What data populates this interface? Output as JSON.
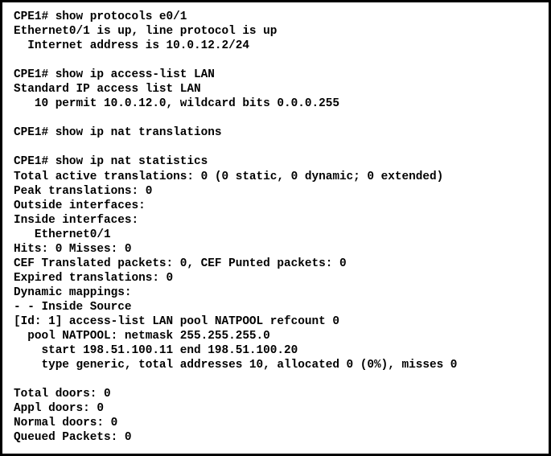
{
  "terminal": {
    "device_hostname": "CPE1",
    "prompt": "CPE1#",
    "foreground_color": "#000000",
    "background_color": "#ffffff",
    "border_color": "#000000",
    "commands": [
      "show protocols e0/1",
      "show ip access-list LAN",
      "show ip nat translations",
      "show ip nat statistics"
    ],
    "lines": [
      "CPE1# show protocols e0/1",
      "Ethernet0/1 is up, line protocol is up",
      "  Internet address is 10.0.12.2/24",
      "",
      "CPE1# show ip access-list LAN",
      "Standard IP access list LAN",
      "   10 permit 10.0.12.0, wildcard bits 0.0.0.255",
      "",
      "CPE1# show ip nat translations",
      "",
      "CPE1# show ip nat statistics",
      "Total active translations: 0 (0 static, 0 dynamic; 0 extended)",
      "Peak translations: 0",
      "Outside interfaces:",
      "Inside interfaces:",
      "   Ethernet0/1",
      "Hits: 0 Misses: 0",
      "CEF Translated packets: 0, CEF Punted packets: 0",
      "Expired translations: 0",
      "Dynamic mappings:",
      "- - Inside Source",
      "[Id: 1] access-list LAN pool NATPOOL refcount 0",
      "  pool NATPOOL: netmask 255.255.255.0",
      "    start 198.51.100.11 end 198.51.100.20",
      "    type generic, total addresses 10, allocated 0 (0%), misses 0",
      "",
      "Total doors: 0",
      "Appl doors: 0",
      "Normal doors: 0",
      "Queued Packets: 0"
    ],
    "values": {
      "interface": "Ethernet0/1",
      "interface_short": "e0/1",
      "interface_status": "up",
      "line_protocol_status": "up",
      "internet_address": "10.0.12.2/24",
      "access_list_name": "LAN",
      "access_list_type": "Standard IP access list",
      "access_list_sequence": "10",
      "access_list_action": "permit",
      "access_list_network": "10.0.12.0",
      "access_list_wildcard": "0.0.0.255",
      "total_active_translations": "0",
      "static_translations": "0",
      "dynamic_translations": "0",
      "extended_translations": "0",
      "peak_translations": "0",
      "outside_interfaces": "",
      "inside_interfaces": "Ethernet0/1",
      "hits": "0",
      "misses": "0",
      "cef_translated_packets": "0",
      "cef_punted_packets": "0",
      "expired_translations": "0",
      "mapping_id": "1",
      "pool_name": "NATPOOL",
      "pool_refcount": "0",
      "pool_netmask": "255.255.255.0",
      "pool_start": "198.51.100.11",
      "pool_end": "198.51.100.20",
      "pool_type": "generic",
      "pool_total_addresses": "10",
      "pool_allocated": "0",
      "pool_allocated_percent": "0%",
      "pool_misses": "0",
      "total_doors": "0",
      "appl_doors": "0",
      "normal_doors": "0",
      "queued_packets": "0"
    }
  }
}
